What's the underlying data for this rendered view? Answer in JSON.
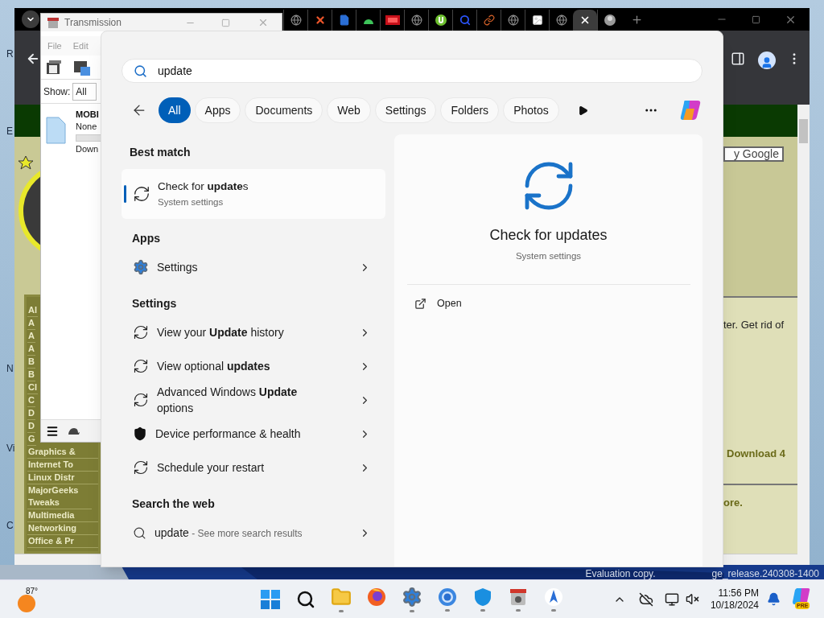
{
  "desktop_labels": [
    "R",
    "E",
    "N",
    "Vi",
    "C"
  ],
  "transmission": {
    "title": "Transmission",
    "menu": [
      "File",
      "Edit"
    ],
    "filter_label": "Show:",
    "filter_value": "All",
    "torrent": {
      "name": "MOBI",
      "status": "None",
      "level": 0,
      "detail": "Down"
    }
  },
  "browser": {
    "tabs": [
      {
        "selected": false
      },
      {
        "selected": false
      },
      {
        "selected": false
      },
      {
        "selected": false
      },
      {
        "selected": false
      },
      {
        "selected": false
      },
      {
        "selected": false
      },
      {
        "selected": false
      },
      {
        "selected": false
      },
      {
        "selected": false
      },
      {
        "selected": false
      },
      {
        "selected": false
      },
      {
        "selected": true
      },
      {
        "selected": false
      }
    ],
    "page": {
      "sidebar_items": [
        "Al",
        "A",
        "A",
        "A",
        "B",
        "B",
        "Cl",
        "C",
        "D",
        "D",
        "G",
        "Graphics &",
        "Internet To",
        "Linux Distr",
        "MajorGeeks Tweaks",
        "Multimedia",
        "Networking",
        "Office & Pr"
      ],
      "search_button": "y Google",
      "text": "ter. Get rid of",
      "link_1": "Download 4",
      "link_2": "ore."
    }
  },
  "start": {
    "query": "update",
    "filters": [
      {
        "label": "All",
        "selected": true
      },
      {
        "label": "Apps",
        "selected": false
      },
      {
        "label": "Documents",
        "selected": false
      },
      {
        "label": "Web",
        "selected": false
      },
      {
        "label": "Settings",
        "selected": false
      },
      {
        "label": "Folders",
        "selected": false
      },
      {
        "label": "Photos",
        "selected": false
      }
    ],
    "best_match": {
      "heading": "Best match",
      "title": "Check for **update**s",
      "subtitle": "System settings"
    },
    "groups": [
      {
        "heading": "Apps",
        "items": [
          {
            "kind": "app",
            "label": "Settings"
          }
        ]
      },
      {
        "heading": "Settings",
        "items": [
          {
            "kind": "sync",
            "label": "View your **Update** history"
          },
          {
            "kind": "sync",
            "label": "View optional **updates**"
          },
          {
            "kind": "sync",
            "label": "Advanced Windows **Update** options"
          },
          {
            "kind": "shield",
            "label": "Device performance & health"
          },
          {
            "kind": "sync",
            "label": "Schedule your restart"
          }
        ]
      },
      {
        "heading": "Search the web",
        "items": [
          {
            "kind": "web",
            "label": "update",
            "suffix": "- See more search results"
          }
        ]
      }
    ],
    "preview": {
      "title": "Check for updates",
      "subtitle": "System settings",
      "action": "Open"
    }
  },
  "watermark": [
    "Evaluation copy.",
    "ge_release.240308-1400"
  ],
  "taskbar": {
    "weather": "87°",
    "apps": [
      {
        "running": true
      },
      {
        "running": false
      },
      {
        "running": true
      },
      {
        "running": true
      },
      {
        "running": true
      },
      {
        "running": true
      },
      {
        "running": true
      }
    ],
    "time": "11:56 PM",
    "date": "10/18/2024",
    "badge": "PRE"
  }
}
